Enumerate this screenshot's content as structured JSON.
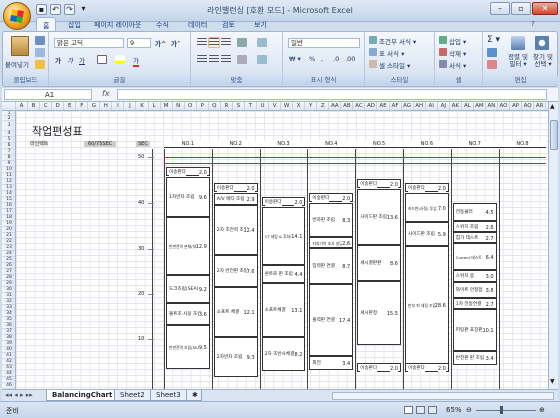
{
  "window": {
    "title": "라인밸런싱 [호환 모드] - Microsoft Excel",
    "controls": [
      "–",
      "▫",
      "✕"
    ]
  },
  "tabs": [
    "홈",
    "삽입",
    "페이지 레이아웃",
    "수식",
    "데이터",
    "검토",
    "보기"
  ],
  "active_tab": "홈",
  "ribbon": {
    "clipboard": {
      "label": "클립보드",
      "paste": "붙여넣기"
    },
    "font": {
      "label": "글꼴",
      "name": "맑은 고딕",
      "size": "9",
      "bold": "가",
      "italic": "가",
      "underline": "가",
      "grow": "가^",
      "shrink": "가˅",
      "fill": "가",
      "color": "가"
    },
    "alignment": {
      "label": "맞춤"
    },
    "number": {
      "label": "표시 형식",
      "format": "일반"
    },
    "styles": {
      "label": "스타일",
      "conditional": "조건부 서식 ▾",
      "table": "표 서식 ▾",
      "cell": "셀 스타일 ▾"
    },
    "cells": {
      "label": "셀",
      "insert": "삽입 ▾",
      "delete": "삭제 ▾",
      "format": "서식 ▾"
    },
    "editing": {
      "label": "편집",
      "sort": "정렬 및 필터 ▾",
      "find": "찾기 및 선택 ▾"
    }
  },
  "formula_bar": {
    "cell": "A1",
    "fx": "fx",
    "value": ""
  },
  "sheet": {
    "columns": [
      "A",
      "B",
      "C",
      "D",
      "E",
      "F",
      "G",
      "H",
      "I",
      "J",
      "K",
      "L",
      "M",
      "N",
      "O",
      "P",
      "Q",
      "R",
      "S",
      "T",
      "U",
      "V",
      "W",
      "X",
      "Y",
      "Z",
      "AA",
      "AB",
      "AC",
      "AD",
      "AE",
      "AF",
      "AG",
      "AH",
      "AI",
      "AJ",
      "AK",
      "AL",
      "AM",
      "AN",
      "AO",
      "AP",
      "AQ",
      "AR",
      "AS"
    ],
    "rows": [
      "1",
      "2",
      "3",
      "4",
      "5",
      "6",
      "7",
      "8",
      "9",
      "10",
      "11",
      "12",
      "13",
      "14",
      "15",
      "16",
      "17",
      "18",
      "19",
      "20",
      "21",
      "22",
      "23",
      "24",
      "25",
      "26",
      "27",
      "28",
      "29",
      "30",
      "31",
      "32",
      "33",
      "34",
      "35",
      "36",
      "37",
      "38",
      "39",
      "40",
      "41",
      "42",
      "43",
      "44",
      "45",
      "46"
    ],
    "title": "작업편성표",
    "meta": {
      "label1": "라인택트",
      "value1": "60/75SEC",
      "label2": "SEC"
    },
    "scale": [
      "50",
      "40",
      "30",
      "20",
      "10"
    ],
    "stations": [
      "NO.1",
      "NO.2",
      "NO.3",
      "NO.4",
      "NO.5",
      "NO.6",
      "NO.7",
      "NO.8"
    ],
    "tasks": [
      {
        "text": "이송판다",
        "val": "2.0"
      },
      {
        "text": "1차반자 조립",
        "val": "9.6"
      },
      {
        "text": "반판전력 본체(대사)",
        "val": "12.9"
      },
      {
        "text": "도크조립(SEA)",
        "val": "9.2"
      },
      {
        "text": "볼트조 사용 조립",
        "val": "3.6"
      },
      {
        "text": "반판전력 조립(SEA)",
        "val": "9.5"
      },
      {
        "text": "이송판다",
        "val": "2.0"
      },
      {
        "text": "A/V 메타 조립",
        "val": "2.9"
      },
      {
        "text": "2차 조전력 조립",
        "val": "12.4"
      },
      {
        "text": "2차 반전판 조립",
        "val": "7.6"
      },
      {
        "text": "소프트 체결",
        "val": "12.1"
      },
      {
        "text": "2차반자 조립",
        "val": "9.3"
      },
      {
        "text": "이송판다",
        "val": "2.0"
      },
      {
        "text": "CT 세팅 & 후처리 조립",
        "val": "14.1"
      },
      {
        "text": "콘트로 판 조립",
        "val": "4.4"
      },
      {
        "text": "소프트체결",
        "val": "13.1"
      },
      {
        "text": "2차 조반사체결",
        "val": "8.2"
      },
      {
        "text": "이송판다",
        "val": "2.0"
      },
      {
        "text": "반자판 조립",
        "val": "8.3"
      },
      {
        "text": "지지기어 조사 실딩",
        "val": "2.6"
      },
      {
        "text": "입력판 연결",
        "val": "8.7"
      },
      {
        "text": "출력판 연결",
        "val": "17.4"
      },
      {
        "text": "회전",
        "val": "3.4"
      },
      {
        "text": "이송판다",
        "val": "2.0"
      },
      {
        "text": "사이드판 조립",
        "val": "13.6"
      },
      {
        "text": "세시결판판",
        "val": "8.6"
      },
      {
        "text": "세시판정",
        "val": "15.5"
      },
      {
        "text": "이송판다",
        "val": "2.0"
      },
      {
        "text": "이송판다",
        "val": "2.0"
      },
      {
        "text": "하드판(사정) 투입",
        "val": "7.0"
      },
      {
        "text": "사이드판 조립",
        "val": "5.9"
      },
      {
        "text": "판부 피 세정 조립",
        "val": "28.6"
      },
      {
        "text": "이송판다",
        "val": "2.0"
      },
      {
        "text": "전동클러",
        "val": "4.5"
      },
      {
        "text": "스위치 조립",
        "val": "2.6"
      },
      {
        "text": "첨가 테스트",
        "val": "2.7"
      },
      {
        "text": "Current 테스트",
        "val": "6.4"
      },
      {
        "text": "스위치 종",
        "val": "3.0"
      },
      {
        "text": "와이트 안정점",
        "val": "3.8"
      },
      {
        "text": "1차 전동연결",
        "val": "2.7"
      },
      {
        "text": "퍼팅판 포장판",
        "val": "10.1"
      },
      {
        "text": "반전판 판 조립",
        "val": "3.4"
      }
    ]
  },
  "sheet_tabs": [
    "BalancingChart",
    "Sheet2",
    "Sheet3"
  ],
  "active_sheet": "BalancingChart",
  "status": {
    "text": "준비",
    "zoom": "65%"
  }
}
